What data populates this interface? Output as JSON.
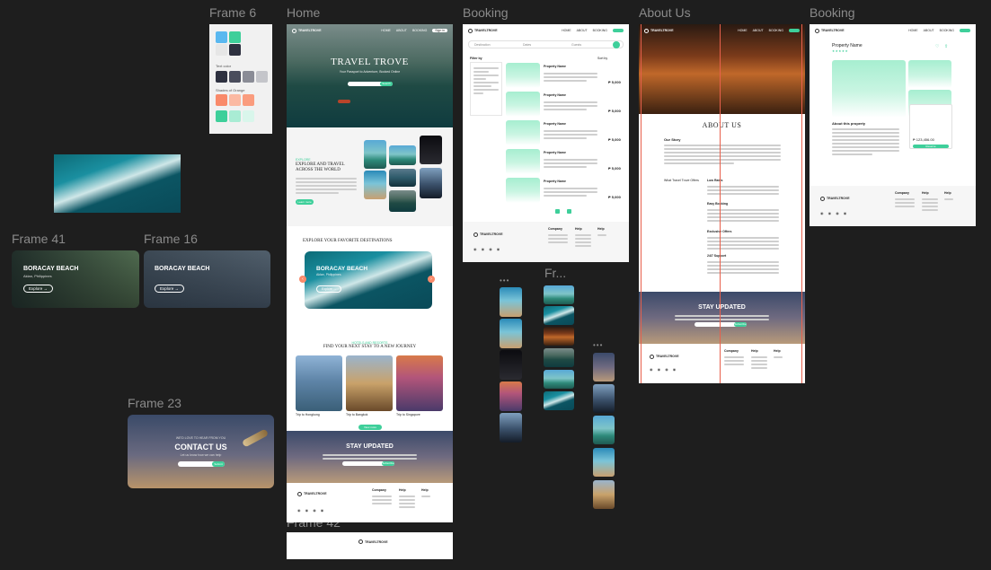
{
  "frames": {
    "frame6": "Frame 6",
    "home": "Home",
    "booking1": "Booking",
    "about": "About Us",
    "booking2": "Booking",
    "frame41": "Frame 41",
    "frame16": "Frame 16",
    "frame23": "Frame 23",
    "frame42": "Frame 42",
    "fr_short": "Fr..."
  },
  "colors": {
    "accent": "#3ecf9a",
    "dark": "#2e3140",
    "orange": "#f9a88a",
    "sky": "#5ab8f0"
  },
  "style_guide": {
    "text_colors_label": "Text color",
    "shades_orange_label": "Shades of Orange"
  },
  "card_beach_a": {
    "title": "BORACAY BEACH",
    "subtitle": "Aklan, Philippines",
    "cta": "Explore"
  },
  "card_beach_b": {
    "title": "BORACAY BEACH",
    "subtitle": "",
    "cta": "Explore"
  },
  "contact": {
    "kicker": "WE'D LOVE TO HEAR FROM YOU",
    "title": "CONTACT US",
    "subtitle": "Let us know how we can help",
    "cta": "Submit"
  },
  "home": {
    "brand": "TRAVELTROVE",
    "nav": [
      "HOME",
      "ABOUT",
      "BOOKING"
    ],
    "nav_cta": "Sign in",
    "hero_title": "TRAVEL TROVE",
    "hero_subtitle": "Your Passport to Adventure, Booked Online",
    "hero_search_cta": "Search",
    "explore_kicker": "EXPLORE",
    "explore_title": "EXPLORE AND TRAVEL ACROSS THE WORLD",
    "explore_cta": "Learn more",
    "dest_title": "EXPLORE YOUR FAVORITE DESTINATIONS",
    "dest_card_title": "BORACAY BEACH",
    "dest_card_sub": "Aklan, Philippines",
    "dest_card_cta": "Explore",
    "stay_kicker": "HOTELS AND RESORTS",
    "stay_title": "FIND YOUR NEXT STAY TO A NEW JOURNEY",
    "stays": [
      "Trip to Hongkong",
      "Trip to Bangkok",
      "Trip to Singapore"
    ],
    "stay_cta": "View more",
    "newsletter_title": "STAY UPDATED",
    "newsletter_cta": "Subscribe",
    "footer_cols": [
      "Company",
      "Help",
      "Help"
    ]
  },
  "booking": {
    "brand": "TRAVELTROVE",
    "nav": [
      "HOME",
      "ABOUT",
      "BOOKING"
    ],
    "search_fields": [
      "Destination",
      "Dates",
      "Guests"
    ],
    "filter_title": "Filter by",
    "sort_label": "Sort by",
    "listings": [
      {
        "title": "Property Name",
        "price": "₱ 5,000"
      },
      {
        "title": "Property Name",
        "price": "₱ 5,000"
      },
      {
        "title": "Property Name",
        "price": "₱ 5,000"
      },
      {
        "title": "Property Name",
        "price": "₱ 5,000"
      },
      {
        "title": "Property Name",
        "price": "₱ 5,000"
      }
    ],
    "footer_cols": [
      "Company",
      "Help",
      "Help"
    ]
  },
  "about_page": {
    "brand": "TRAVELTROVE",
    "nav": [
      "HOME",
      "ABOUT",
      "BOOKING"
    ],
    "title": "ABOUT US",
    "our_story": "Our Story",
    "offers_title": "What Travel Trove Offers",
    "offers": [
      "Low Rates",
      "Easy Booking",
      "Exclusive Offers",
      "24/7 Support"
    ],
    "newsletter_title": "STAY UPDATED",
    "newsletter_cta": "Subscribe",
    "footer_cols": [
      "Company",
      "Help",
      "Help"
    ]
  },
  "property_page": {
    "brand": "TRAVELTROVE",
    "nav": [
      "HOME",
      "ABOUT",
      "BOOKING"
    ],
    "title": "Property Name",
    "about_title": "About this property",
    "price": "₱ 123,456.00",
    "book_cta": "Reserve",
    "footer_cols": [
      "Company",
      "Help",
      "Help"
    ]
  }
}
